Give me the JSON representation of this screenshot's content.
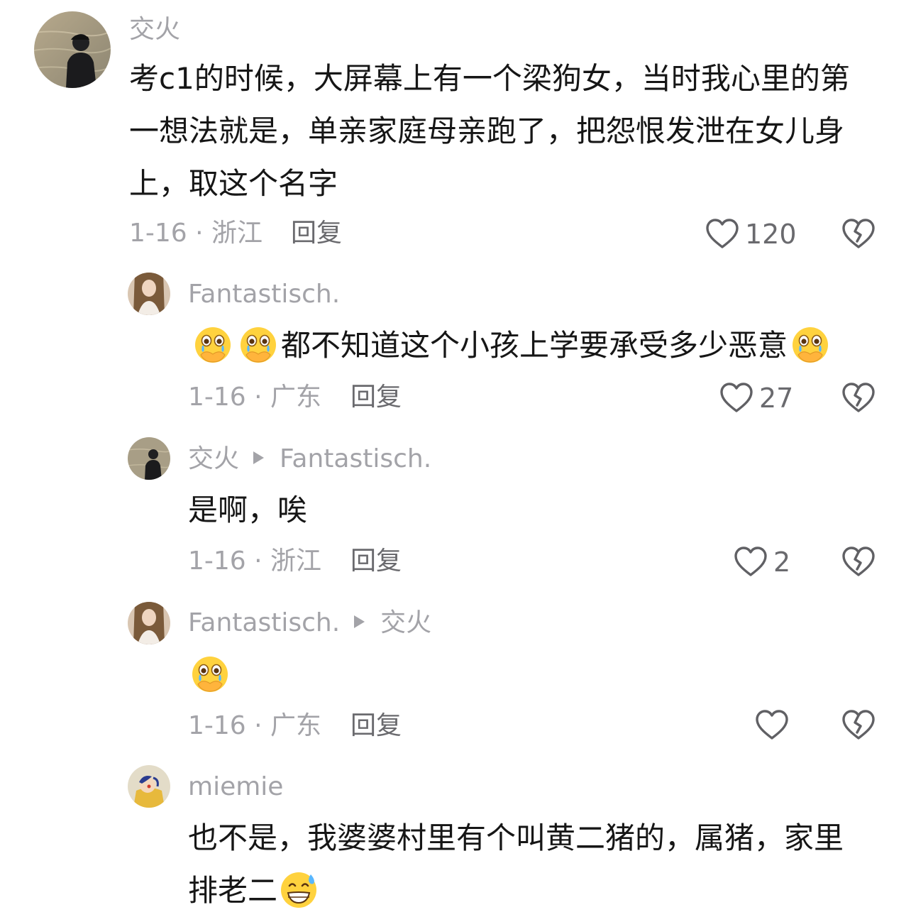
{
  "comments": [
    {
      "user": "交火",
      "text": "考c1的时候，大屏幕上有一个梁狗女，当时我心里的第一想法就是，单亲家庭母亲跑了，把怨恨发泄在女儿身上，取这个名字",
      "meta": "1-16 · 浙江",
      "reply_label": "回复",
      "likes": "120"
    },
    {
      "user": "Fantastisch.",
      "text": "都不知道这个小孩上学要承受多少恶意",
      "meta": "1-16 · 广东",
      "reply_label": "回复",
      "likes": "27"
    },
    {
      "user": "交火",
      "reply_to": "Fantastisch.",
      "text": "是啊，唉",
      "meta": "1-16 · 浙江",
      "reply_label": "回复",
      "likes": "2"
    },
    {
      "user": "Fantastisch.",
      "reply_to": "交火",
      "text": "",
      "meta": "1-16 · 广东",
      "reply_label": "回复",
      "likes": ""
    },
    {
      "user": "miemie",
      "text_line1": "也不是，我婆婆村里有个叫黄二猪的，属猪，家里",
      "text_line2": "排老二",
      "meta": "",
      "reply_label": "",
      "likes": ""
    }
  ],
  "icons": {
    "like": "heart-outline-icon",
    "dislike": "broken-heart-icon",
    "cry_emoji": "crying-hands-over-mouth-emoji",
    "grin_sweat_emoji": "grinning-sweat-emoji"
  },
  "colors": {
    "text": "#161616",
    "muted": "#a3a3a8",
    "reply": "#6a6a6e",
    "background": "#ffffff"
  }
}
